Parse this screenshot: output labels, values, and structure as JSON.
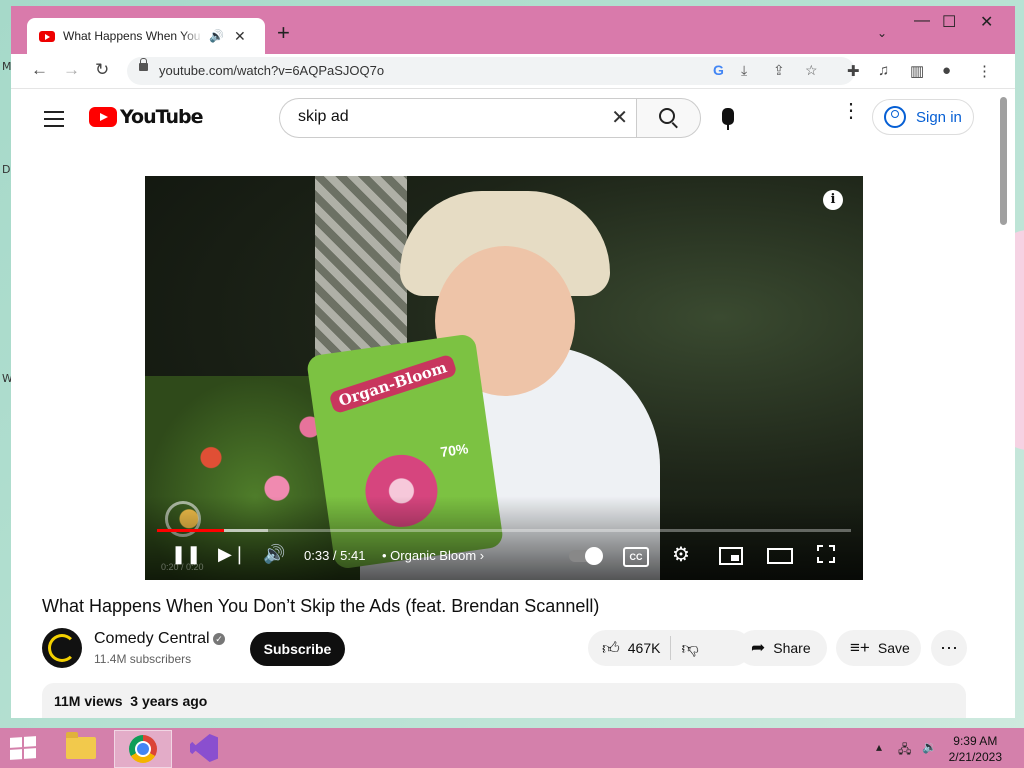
{
  "tab": {
    "title": "What Happens When You Don't Skip the Ads (feat. Brendan Scannell)"
  },
  "window_controls": {
    "minimize": "—",
    "maximize": "☐",
    "close": "✕"
  },
  "address": {
    "url": "youtube.com/watch?v=6AQPaSJOQ7o"
  },
  "youtube": {
    "logo_text": "YouTube",
    "search_value": "skip ad",
    "sign_in": "Sign in"
  },
  "player": {
    "current_time": "0:33",
    "duration": "5:41",
    "time_display": "0:33 / 5:41",
    "chapter": "Organic Bloom",
    "played_fraction": 0.097,
    "buffered_fraction": 0.16,
    "ad_product": "Organ-Bloom",
    "ad_percent": "70%",
    "ghost_time": "0:20 / 0:20"
  },
  "video": {
    "title": "What Happens When You Don’t Skip the Ads (feat. Brendan Scannell)",
    "channel": "Comedy Central",
    "subscribers": "11.4M subscribers",
    "subscribe_label": "Subscribe",
    "likes": "467K",
    "share_label": "Share",
    "save_label": "Save",
    "views": "11M views",
    "age": "3 years ago"
  },
  "taskbar": {
    "time": "9:39 AM",
    "date": "2/21/2023"
  },
  "desktop_fragments": [
    "M",
    "D",
    "W"
  ],
  "colors": {
    "window_frame": "#d97aab",
    "yt_red": "#ff0000",
    "link_blue": "#065fd4"
  }
}
